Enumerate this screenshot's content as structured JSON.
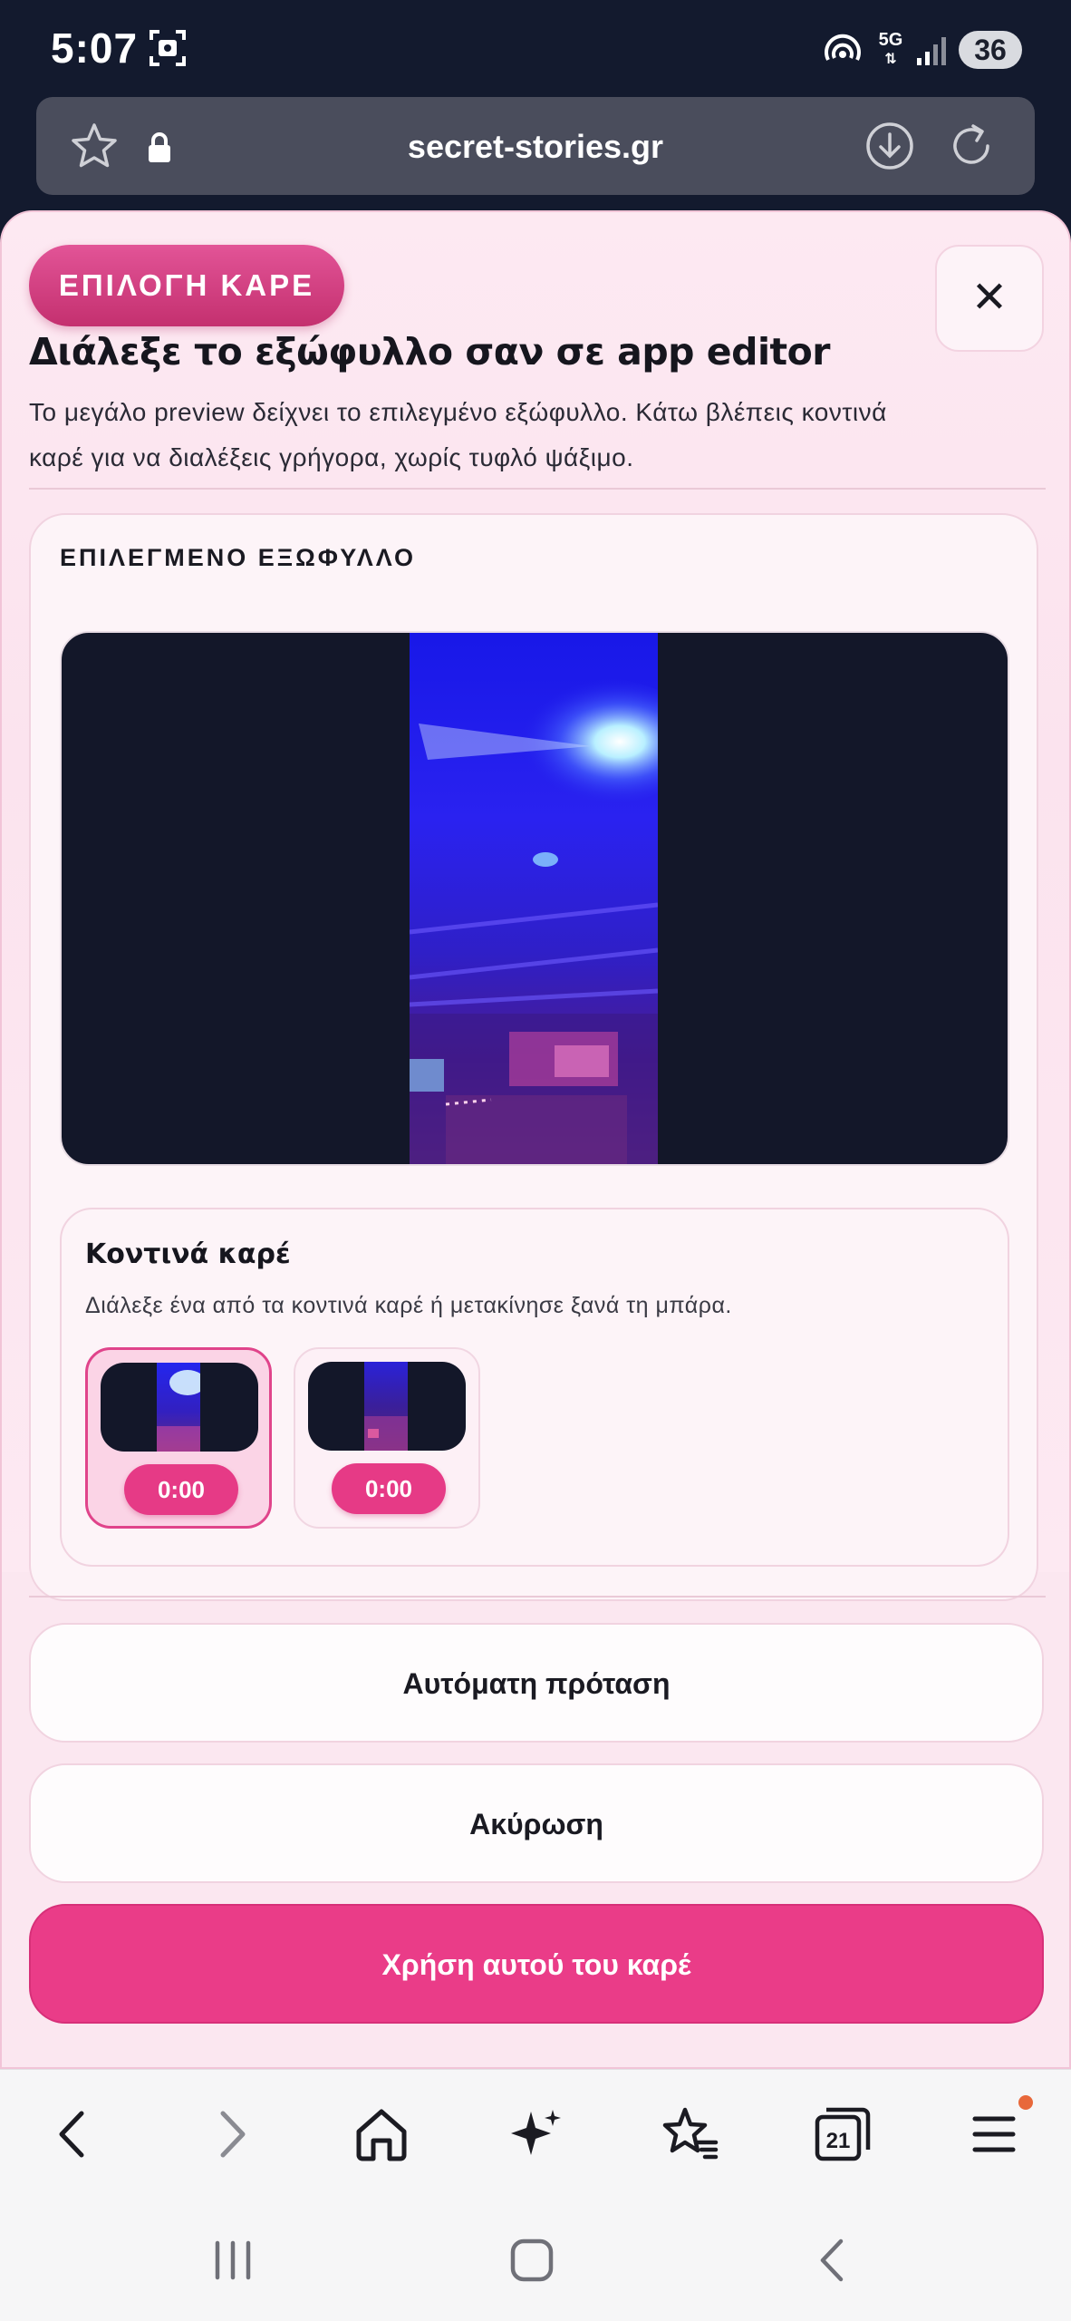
{
  "status_bar": {
    "time": "5:07",
    "network": "5G",
    "battery": "36"
  },
  "browser": {
    "url": "secret-stories.gr"
  },
  "modal": {
    "badge": "ΕΠΙΛΟΓΗ ΚΑΡΕ",
    "title": "Διάλεξε το εξώφυλλο σαν σε app editor",
    "description": "Το μεγάλο preview δείχνει το επιλεγμένο εξώφυλλο. Κάτω βλέπεις κοντινά καρέ για να διαλέξεις γρήγορα, χωρίς τυφλό ψάξιμο.",
    "close_icon": "close-icon",
    "selected_cover_label": "ΕΠΙΛΕΓΜΕΝΟ ΕΞΩΦΥΛΛΟ",
    "nearby": {
      "title": "Κοντινά καρέ",
      "description": "Διάλεξε ένα από τα κοντινά καρέ ή μετακίνησε ξανά τη μπάρα.",
      "frames": [
        {
          "time": "0:00",
          "selected": true
        },
        {
          "time": "0:00",
          "selected": false
        }
      ]
    },
    "auto_suggest_label": "Αυτόματη πρόταση",
    "cancel_label": "Ακύρωση",
    "use_frame_label": "Χρήση αυτού του καρέ"
  },
  "colors": {
    "accent": "#ea3c88",
    "badge": "#d63f82",
    "page_bg": "#fbe7f0",
    "dark_bg": "#131a2e"
  }
}
